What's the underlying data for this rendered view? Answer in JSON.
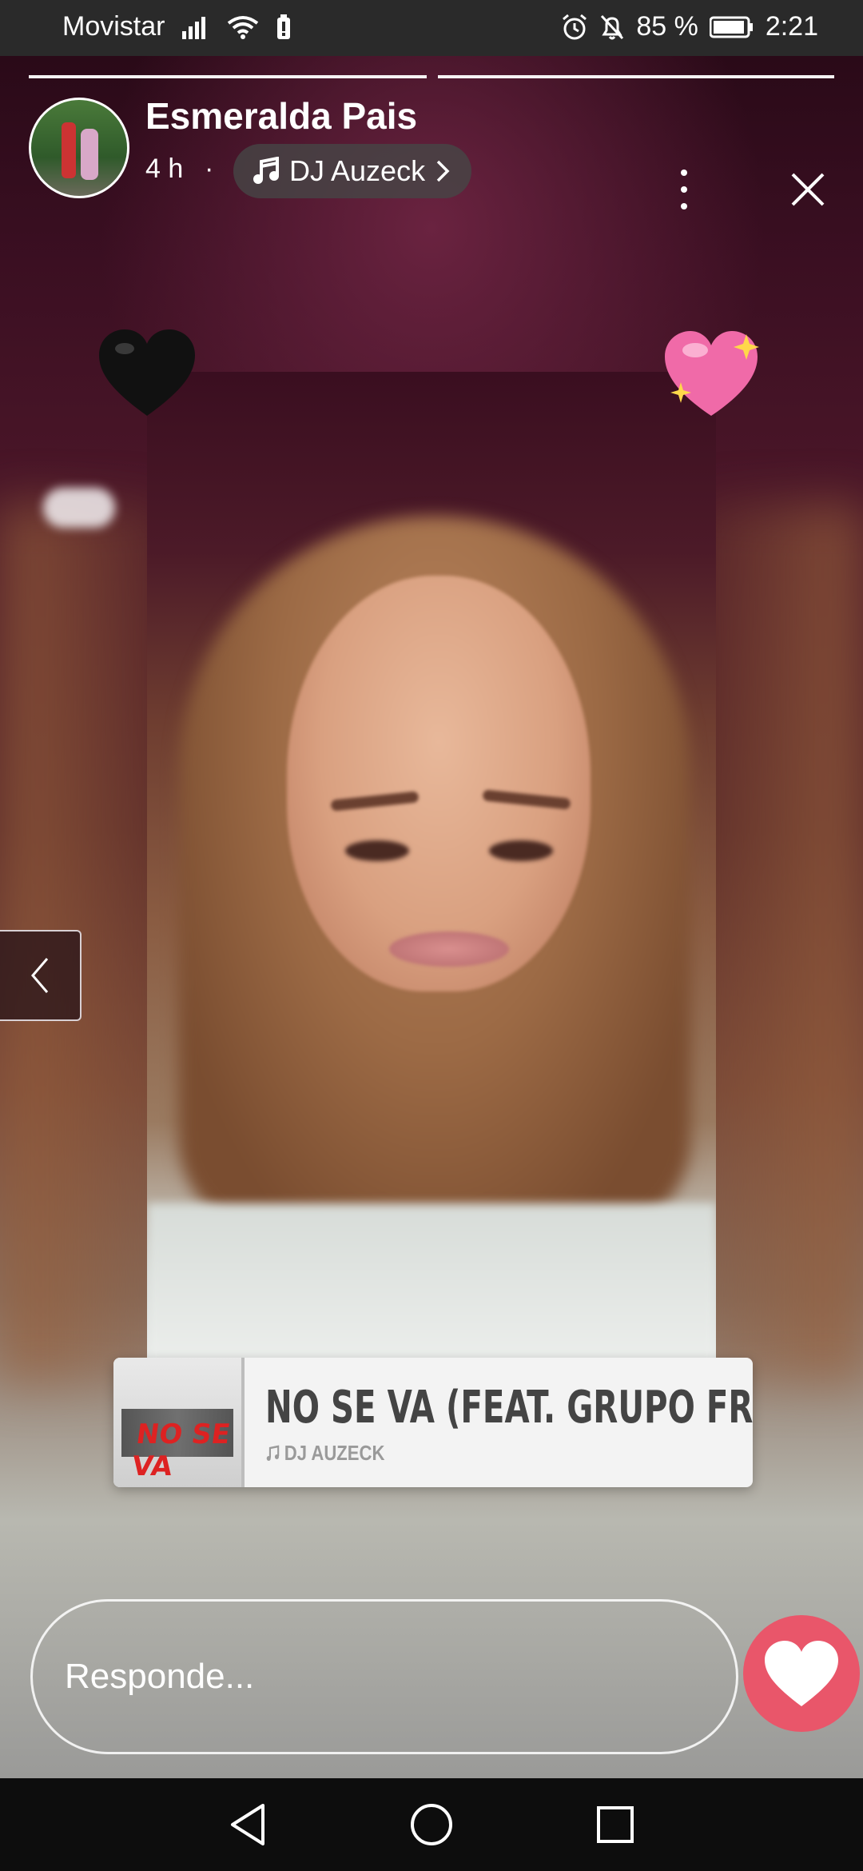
{
  "status_bar": {
    "carrier": "Movistar",
    "battery_percent": "85 %",
    "time": "2:21"
  },
  "story": {
    "progress_segments": 2,
    "active_segment": 1,
    "author": {
      "name": "Esmeralda Pais",
      "time_ago": "4 h",
      "separator": "·"
    },
    "music": {
      "artist_chip": "DJ Auzeck",
      "sticker_title": "NO SE VA  (FEAT. GRUPO FRO",
      "sticker_artist": "DJ AUZECK",
      "album_art_text": "NO SE VA"
    }
  },
  "reply": {
    "placeholder": "Responde..."
  },
  "colors": {
    "like_button": "#e9566a",
    "status_bar_bg": "#2a2a2a",
    "nav_bar_bg": "#0d0d0d"
  },
  "icons": [
    "signal-icon",
    "wifi-icon",
    "battery-saver-icon",
    "alarm-icon",
    "bell-off-icon",
    "battery-icon",
    "music-note-icon",
    "chevron-right-icon",
    "more-vertical-icon",
    "close-icon",
    "chevron-left-icon",
    "heart-icon",
    "back-nav-icon",
    "home-nav-icon",
    "recents-nav-icon"
  ]
}
